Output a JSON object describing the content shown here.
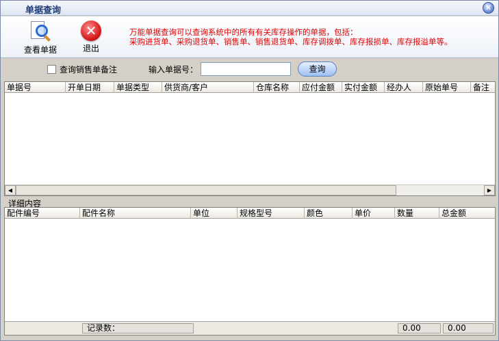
{
  "window": {
    "title": "单据查询"
  },
  "toolbar": {
    "view_label": "查看单据",
    "exit_label": "退出",
    "notice_line1": "万能单据查询可以查询系统中的所有有关库存操作的单据，包括：",
    "notice_line2": "采购进货单、采购退货单、销售单、销售退货单、库存调拨单、库存报损单、库存报溢单等。"
  },
  "search": {
    "checkbox_label": "查询销售单备注",
    "bill_label": "输入单据号：",
    "bill_value": "",
    "query_label": "查询"
  },
  "main_table": {
    "columns": [
      "单据号",
      "开单日期",
      "单据类型",
      "供货商/客户",
      "仓库名称",
      "应付金额",
      "实付金额",
      "经办人",
      "原始单号",
      "备注"
    ]
  },
  "detail": {
    "caption": "详细内容",
    "columns": [
      "配件编号",
      "配件名称",
      "单位",
      "规格型号",
      "颜色",
      "单价",
      "数量",
      "总金额"
    ],
    "record_label": "记录数：",
    "sum1": "0.00",
    "sum2": "0.00"
  }
}
